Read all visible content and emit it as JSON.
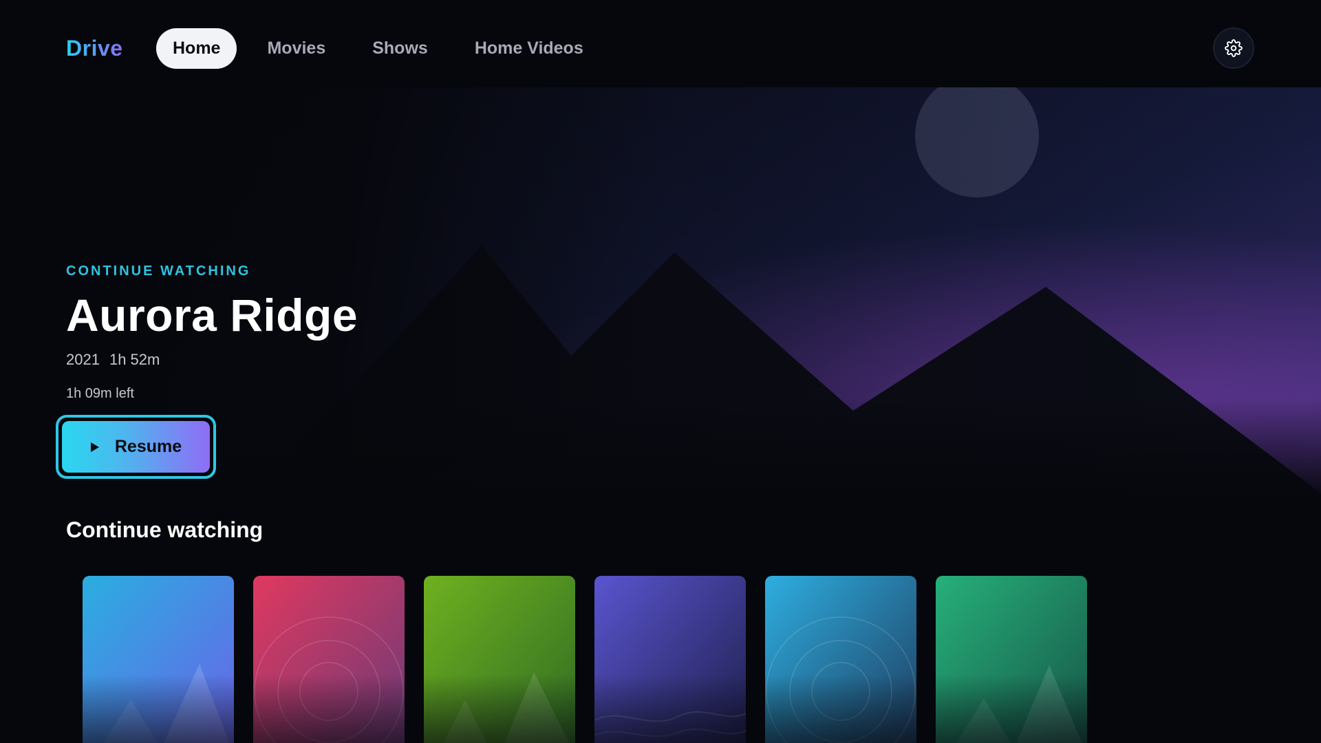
{
  "app": {
    "name": "Drive"
  },
  "nav": {
    "tabs": [
      {
        "label": "Home",
        "active": true
      },
      {
        "label": "Movies",
        "active": false
      },
      {
        "label": "Shows",
        "active": false
      },
      {
        "label": "Home Videos",
        "active": false
      }
    ],
    "settings_icon": "gear-icon"
  },
  "hero": {
    "eyebrow": "CONTINUE WATCHING",
    "title": "Aurora Ridge",
    "year": "2021",
    "duration": "1h 52m",
    "time_left": "1h 09m left",
    "resume_label": "Resume",
    "resume_icon": "play-icon"
  },
  "row": {
    "title": "Continue watching",
    "cards": [
      {
        "theme": "mountains",
        "color_from": "#2aaee0",
        "color_to": "#6a63e8"
      },
      {
        "theme": "circles",
        "color_from": "#e0395f",
        "color_to": "#6a3a78"
      },
      {
        "theme": "mountains",
        "color_from": "#6fb11f",
        "color_to": "#2e6a24"
      },
      {
        "theme": "waves",
        "color_from": "#5a55cf",
        "color_to": "#1c1d48"
      },
      {
        "theme": "circles",
        "color_from": "#2eaee0",
        "color_to": "#1e3a5c"
      },
      {
        "theme": "mountains",
        "color_from": "#26b07a",
        "color_to": "#175446"
      }
    ]
  },
  "colors": {
    "accent_cyan": "#2fc7e6",
    "accent_purple": "#8f6df5",
    "background": "#06070c"
  }
}
